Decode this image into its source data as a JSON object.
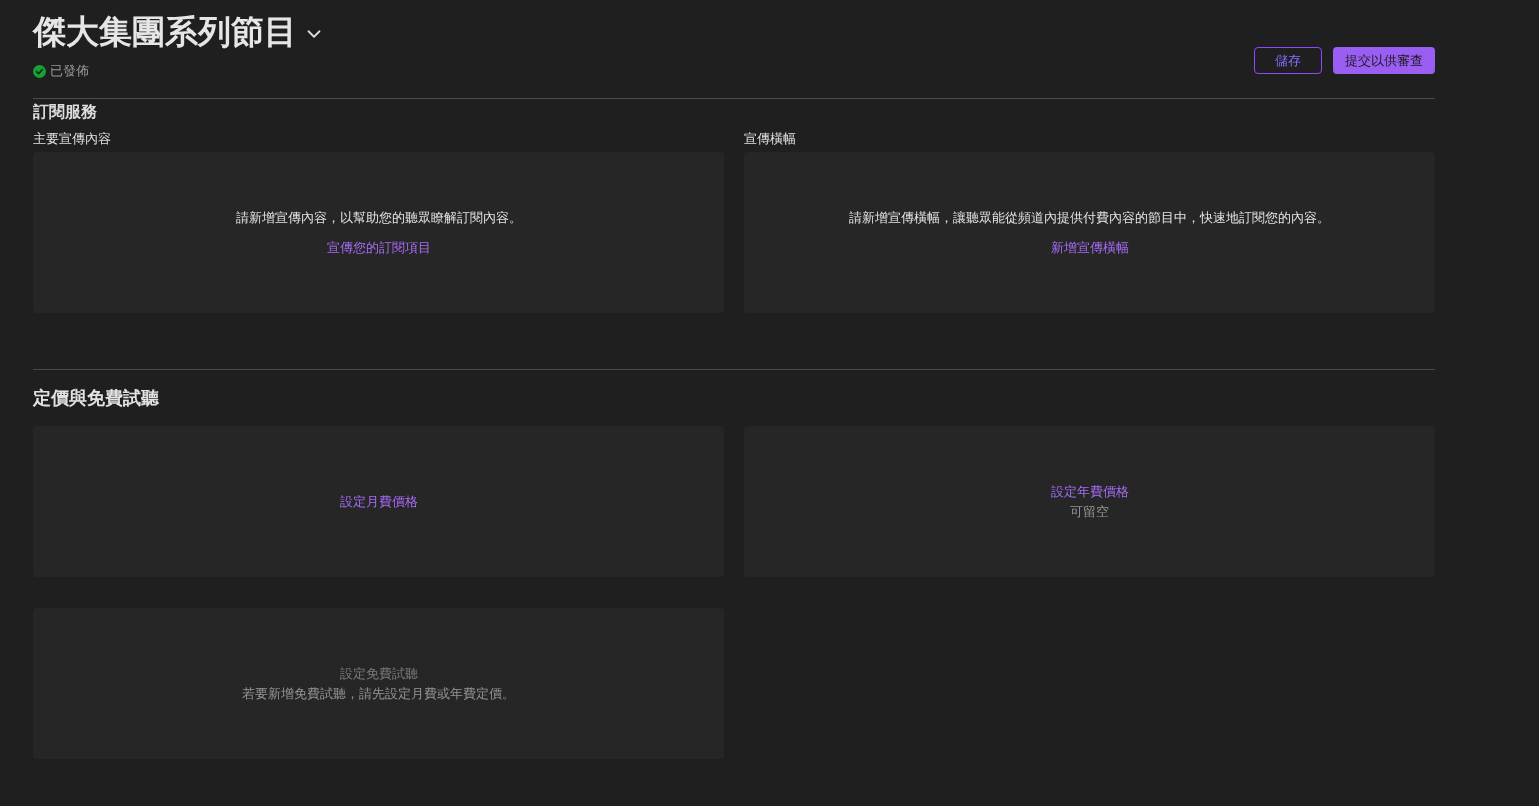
{
  "header": {
    "title": "傑大集團系列節目",
    "status": "已發佈",
    "buttons": [
      {
        "label": "儲存",
        "kind": "secondary"
      },
      {
        "label": "提交以供審查",
        "kind": "primary"
      }
    ]
  },
  "subscription_section": {
    "heading": "訂閱服務",
    "panels": [
      {
        "label": "主要宣傳內容",
        "message": "請新增宣傳內容，以幫助您的聽眾瞭解訂閱內容。",
        "link": {
          "label": "宣傳您的訂閱項目",
          "disabled": false
        }
      },
      {
        "label": "宣傳橫幅",
        "message": "請新增宣傳橫幅，讓聽眾能從頻道內提供付費內容的節目中，快速地訂閱您的內容。",
        "link": {
          "label": "新增宣傳橫幅",
          "disabled": false
        }
      }
    ]
  },
  "pricing_section": {
    "heading": "定價與免費試聽",
    "cards": [
      {
        "link": {
          "label": "設定月費價格",
          "disabled": false
        }
      },
      {
        "link": {
          "label": "設定年費價格",
          "disabled": false
        },
        "note": "可留空"
      },
      {
        "link": {
          "label": "設定免費試聽",
          "disabled": true
        },
        "note": "若要新增免費試聽，請先設定月費或年費定價。"
      }
    ]
  }
}
